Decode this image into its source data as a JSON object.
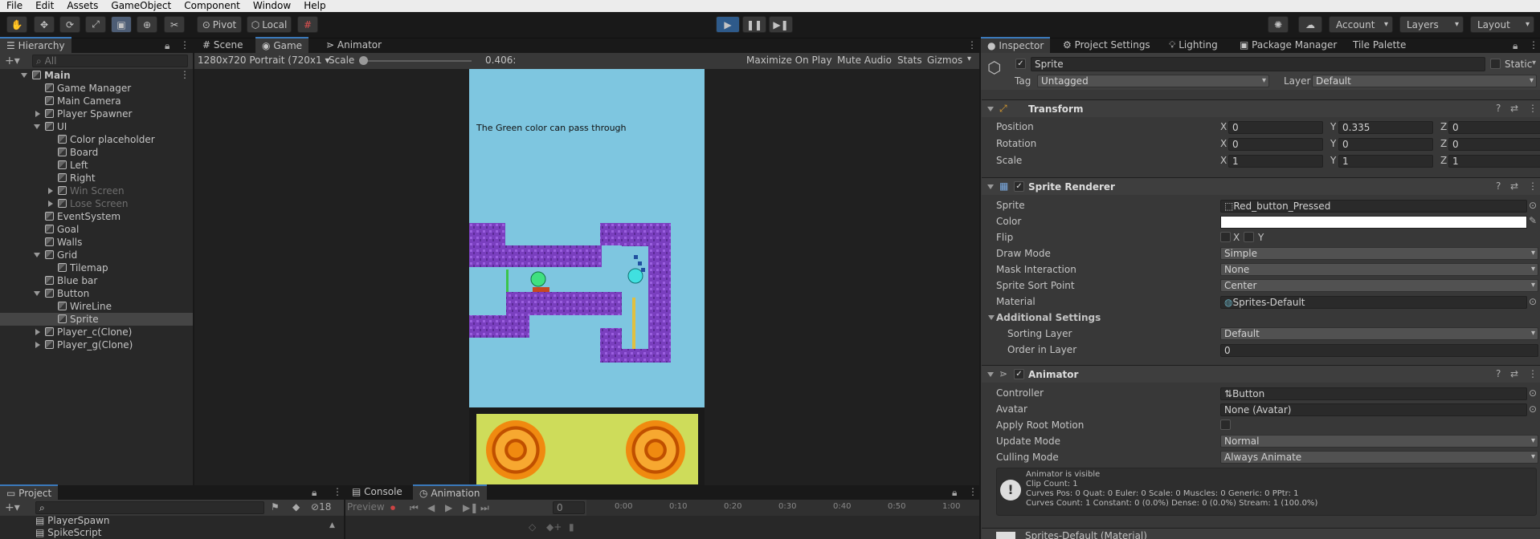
{
  "menu": [
    "File",
    "Edit",
    "Assets",
    "GameObject",
    "Component",
    "Window",
    "Help"
  ],
  "toolbar": {
    "pivot_label": "Pivot",
    "local_label": "Local",
    "account_label": "Account",
    "layers_label": "Layers",
    "layout_label": "Layout"
  },
  "hierarchy": {
    "tab_label": "Hierarchy",
    "search_placeholder": "All",
    "items": [
      {
        "label": "Main",
        "depth": 0,
        "expand": "open"
      },
      {
        "label": "Game Manager",
        "depth": 1
      },
      {
        "label": "Main Camera",
        "depth": 1
      },
      {
        "label": "Player Spawner",
        "depth": 1,
        "expand": "closed"
      },
      {
        "label": "UI",
        "depth": 1,
        "expand": "open"
      },
      {
        "label": "Color placeholder",
        "depth": 2
      },
      {
        "label": "Board",
        "depth": 2
      },
      {
        "label": "Left",
        "depth": 2
      },
      {
        "label": "Right",
        "depth": 2
      },
      {
        "label": "Win Screen",
        "depth": 2,
        "expand": "closed",
        "dim": true
      },
      {
        "label": "Lose Screen",
        "depth": 2,
        "expand": "closed",
        "dim": true
      },
      {
        "label": "EventSystem",
        "depth": 1
      },
      {
        "label": "Goal",
        "depth": 1
      },
      {
        "label": "Walls",
        "depth": 1
      },
      {
        "label": "Grid",
        "depth": 1,
        "expand": "open"
      },
      {
        "label": "Tilemap",
        "depth": 2
      },
      {
        "label": "Blue bar",
        "depth": 1
      },
      {
        "label": "Button",
        "depth": 1,
        "expand": "open"
      },
      {
        "label": "WireLine",
        "depth": 2
      },
      {
        "label": "Sprite",
        "depth": 2,
        "selected": true
      },
      {
        "label": "Player_c(Clone)",
        "depth": 1,
        "expand": "closed"
      },
      {
        "label": "Player_g(Clone)",
        "depth": 1,
        "expand": "closed"
      }
    ]
  },
  "game_view": {
    "tabs": [
      "Scene",
      "Game",
      "Animator"
    ],
    "resolution": "1280x720 Portrait (720x1",
    "scale_label": "Scale",
    "scale_value": "0.406:",
    "maximize": "Maximize On Play",
    "mute": "Mute Audio",
    "stats": "Stats",
    "gizmos": "Gizmos",
    "hint_text": "The Green color can pass through"
  },
  "project": {
    "tabs": [
      "Project",
      "Console",
      "Animation"
    ],
    "hidden_count": "18",
    "files": [
      "PlayerSpawn",
      "SpikeScript"
    ],
    "preview_label": "Preview",
    "frame": "0",
    "ticks": [
      "0:00",
      "0:10",
      "0:20",
      "0:30",
      "0:40",
      "0:50",
      "1:00"
    ]
  },
  "inspector": {
    "tabs": [
      "Inspector",
      "Project Settings",
      "Lighting",
      "Package Manager",
      "Tile Palette"
    ],
    "object_name": "Sprite",
    "static_label": "Static",
    "tag_label": "Tag",
    "tag_value": "Untagged",
    "layer_label": "Layer",
    "layer_value": "Default",
    "transform": {
      "title": "Transform",
      "rows": [
        {
          "label": "Position",
          "x": "0",
          "y": "0.335",
          "z": "0"
        },
        {
          "label": "Rotation",
          "x": "0",
          "y": "0",
          "z": "0"
        },
        {
          "label": "Scale",
          "x": "1",
          "y": "1",
          "z": "1"
        }
      ]
    },
    "sprite_renderer": {
      "title": "Sprite Renderer",
      "sprite_label": "Sprite",
      "sprite_value": "Red_button_Pressed",
      "color_label": "Color",
      "flip_label": "Flip",
      "flip_x": "X",
      "flip_y": "Y",
      "draw_mode_label": "Draw Mode",
      "draw_mode_value": "Simple",
      "mask_label": "Mask Interaction",
      "mask_value": "None",
      "sort_point_label": "Sprite Sort Point",
      "sort_point_value": "Center",
      "material_label": "Material",
      "material_value": "Sprites-Default",
      "additional_label": "Additional Settings",
      "sorting_layer_label": "Sorting Layer",
      "sorting_layer_value": "Default",
      "order_label": "Order in Layer",
      "order_value": "0"
    },
    "animator": {
      "title": "Animator",
      "controller_label": "Controller",
      "controller_value": "Button",
      "avatar_label": "Avatar",
      "avatar_value": "None (Avatar)",
      "root_motion_label": "Apply Root Motion",
      "update_mode_label": "Update Mode",
      "update_mode_value": "Normal",
      "culling_label": "Culling Mode",
      "culling_value": "Always Animate",
      "info_lines": [
        "Animator is visible",
        "Clip Count: 1",
        "Curves Pos: 0 Quat: 0 Euler: 0 Scale: 0 Muscles: 0 Generic: 0 PPtr: 1",
        "Curves Count: 1 Constant: 0 (0.0%) Dense: 0 (0.0%) Stream: 1 (100.0%)"
      ]
    },
    "material_footer": "Sprites-Default (Material)"
  },
  "colors": {
    "accent": "#3a79bb",
    "sky": "#7ec6e0",
    "wall": "#7a3fbf",
    "board": "#cedc5a",
    "coin": "#f08a10"
  }
}
